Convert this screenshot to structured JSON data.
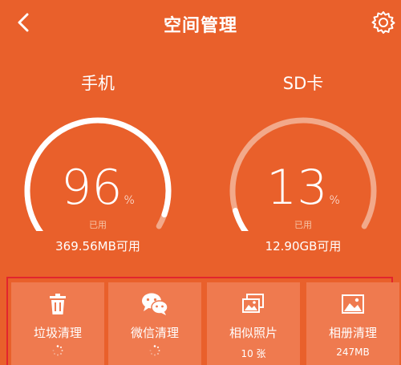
{
  "header": {
    "title": "空间管理"
  },
  "storage": {
    "phone": {
      "label": "手机",
      "percent": 96,
      "percent_text": "96",
      "unit": "%",
      "used_label": "已用",
      "available": "369.56MB可用"
    },
    "sd": {
      "label": "SD卡",
      "percent": 13,
      "percent_text": "13",
      "unit": "%",
      "used_label": "已用",
      "available": "12.90GB可用"
    }
  },
  "tiles": [
    {
      "label": "垃圾清理",
      "icon": "trash-icon",
      "sub": ""
    },
    {
      "label": "微信清理",
      "icon": "wechat-icon",
      "sub": ""
    },
    {
      "label": "相似照片",
      "icon": "photos-icon",
      "sub": "10 张"
    },
    {
      "label": "相册清理",
      "icon": "image-icon",
      "sub": "247MB"
    }
  ],
  "colors": {
    "background": "#E9602B",
    "tile": "#EF7A4F",
    "highlight_border": "#E2252E"
  }
}
